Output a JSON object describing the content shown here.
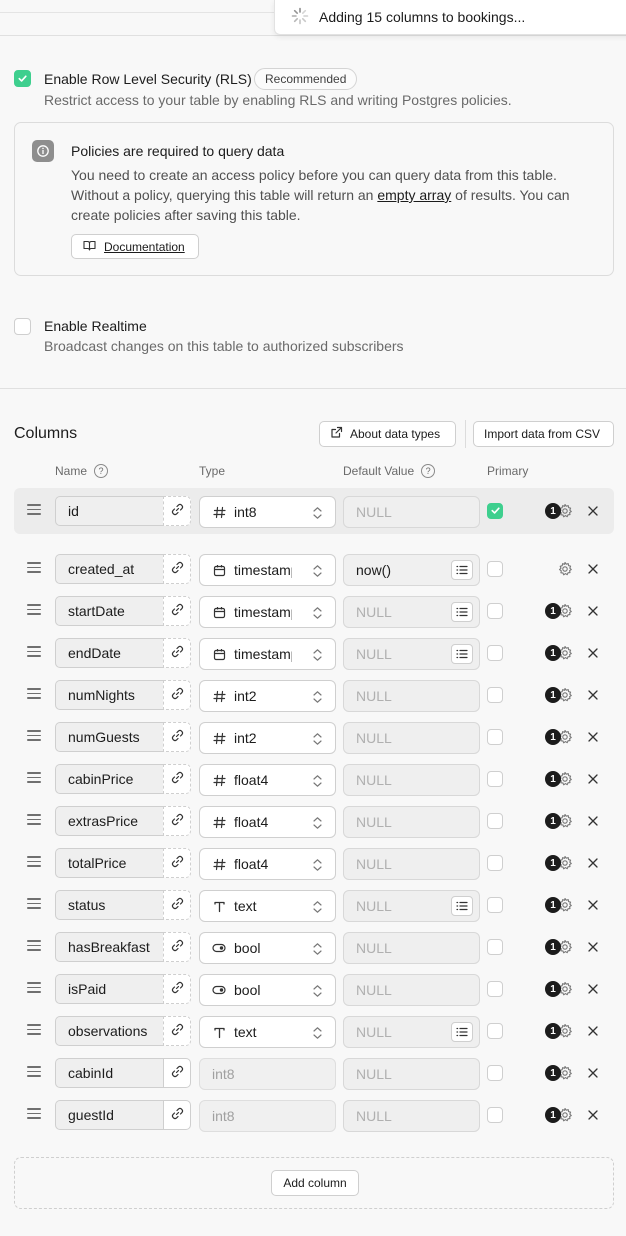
{
  "toast": {
    "text": "Adding 15 columns to bookings..."
  },
  "rls": {
    "label": "Enable Row Level Security (RLS)",
    "badge": "Recommended",
    "description": "Restrict access to your table by enabling RLS and writing Postgres policies.",
    "checked": true
  },
  "notice": {
    "title": "Policies are required to query data",
    "body_before": "You need to create an access policy before you can query data from this table. Without a policy, querying this table will return an ",
    "body_link": "empty array",
    "body_after": " of results. You can create policies after saving this table.",
    "doc_button": "Documentation"
  },
  "realtime": {
    "label": "Enable Realtime",
    "description": "Broadcast changes on this table to authorized subscribers",
    "checked": false
  },
  "columns_section": {
    "title": "Columns",
    "about_button": "About data types",
    "import_button": "Import data from CSV",
    "headers": {
      "name": "Name",
      "type": "Type",
      "default": "Default Value",
      "primary": "Primary"
    },
    "help_glyph": "?",
    "add_button": "Add column"
  },
  "columns": [
    {
      "name": "id",
      "type": "int8",
      "type_icon": "hash-icon",
      "default": "NULL",
      "default_is_value": false,
      "list_button": false,
      "primary": true,
      "badge": "1",
      "type_disabled": false,
      "link_solid": false
    },
    {
      "name": "created_at",
      "type": "timestamptz",
      "type_icon": "calendar-icon",
      "default": "now()",
      "default_is_value": true,
      "list_button": true,
      "primary": false,
      "badge": "",
      "type_disabled": false,
      "link_solid": false
    },
    {
      "name": "startDate",
      "type": "timestamptz",
      "type_icon": "calendar-icon",
      "default": "NULL",
      "default_is_value": false,
      "list_button": true,
      "primary": false,
      "badge": "1",
      "type_disabled": false,
      "link_solid": false
    },
    {
      "name": "endDate",
      "type": "timestamptz",
      "type_icon": "calendar-icon",
      "default": "NULL",
      "default_is_value": false,
      "list_button": true,
      "primary": false,
      "badge": "1",
      "type_disabled": false,
      "link_solid": false
    },
    {
      "name": "numNights",
      "type": "int2",
      "type_icon": "hash-icon",
      "default": "NULL",
      "default_is_value": false,
      "list_button": false,
      "primary": false,
      "badge": "1",
      "type_disabled": false,
      "link_solid": false
    },
    {
      "name": "numGuests",
      "type": "int2",
      "type_icon": "hash-icon",
      "default": "NULL",
      "default_is_value": false,
      "list_button": false,
      "primary": false,
      "badge": "1",
      "type_disabled": false,
      "link_solid": false
    },
    {
      "name": "cabinPrice",
      "type": "float4",
      "type_icon": "hash-icon",
      "default": "NULL",
      "default_is_value": false,
      "list_button": false,
      "primary": false,
      "badge": "1",
      "type_disabled": false,
      "link_solid": false
    },
    {
      "name": "extrasPrice",
      "type": "float4",
      "type_icon": "hash-icon",
      "default": "NULL",
      "default_is_value": false,
      "list_button": false,
      "primary": false,
      "badge": "1",
      "type_disabled": false,
      "link_solid": false
    },
    {
      "name": "totalPrice",
      "type": "float4",
      "type_icon": "hash-icon",
      "default": "NULL",
      "default_is_value": false,
      "list_button": false,
      "primary": false,
      "badge": "1",
      "type_disabled": false,
      "link_solid": false
    },
    {
      "name": "status",
      "type": "text",
      "type_icon": "text-icon",
      "default": "NULL",
      "default_is_value": false,
      "list_button": true,
      "primary": false,
      "badge": "1",
      "type_disabled": false,
      "link_solid": false
    },
    {
      "name": "hasBreakfast",
      "type": "bool",
      "type_icon": "toggle-icon",
      "default": "NULL",
      "default_is_value": false,
      "list_button": false,
      "primary": false,
      "badge": "1",
      "type_disabled": false,
      "link_solid": false
    },
    {
      "name": "isPaid",
      "type": "bool",
      "type_icon": "toggle-icon",
      "default": "NULL",
      "default_is_value": false,
      "list_button": false,
      "primary": false,
      "badge": "1",
      "type_disabled": false,
      "link_solid": false
    },
    {
      "name": "observations",
      "type": "text",
      "type_icon": "text-icon",
      "default": "NULL",
      "default_is_value": false,
      "list_button": true,
      "primary": false,
      "badge": "1",
      "type_disabled": false,
      "link_solid": false
    },
    {
      "name": "cabinId",
      "type": "int8",
      "type_icon": "",
      "default": "NULL",
      "default_is_value": false,
      "list_button": false,
      "primary": false,
      "badge": "1",
      "type_disabled": true,
      "link_solid": true
    },
    {
      "name": "guestId",
      "type": "int8",
      "type_icon": "",
      "default": "NULL",
      "default_is_value": false,
      "list_button": false,
      "primary": false,
      "badge": "1",
      "type_disabled": true,
      "link_solid": true
    }
  ],
  "colors": {
    "accent": "#3ecf8e",
    "background": "#f8f8f8"
  }
}
